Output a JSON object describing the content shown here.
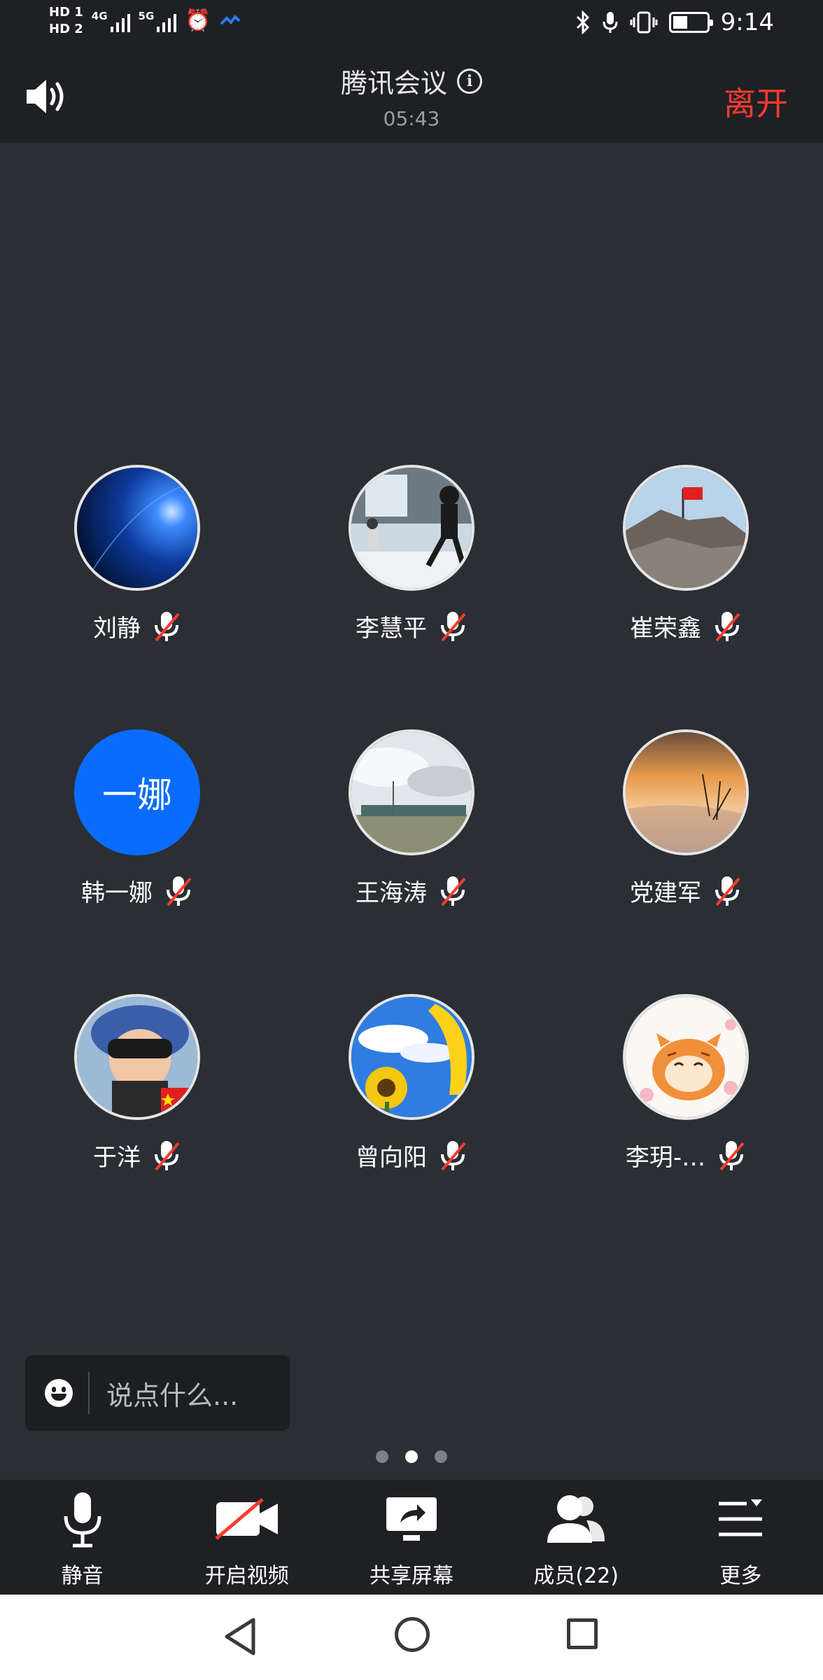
{
  "status_bar": {
    "sim1": "HD 1",
    "sim2": "HD 2",
    "network1": "4G",
    "network2": "5G",
    "time": "9:14"
  },
  "header": {
    "title": "腾讯会议",
    "timer": "05:43",
    "leave_label": "离开"
  },
  "participants": [
    {
      "name": "刘静",
      "avatar": "photo-earth-blue",
      "muted": true
    },
    {
      "name": "李慧平",
      "avatar": "photo-kids-playing",
      "muted": true
    },
    {
      "name": "崔荣鑫",
      "avatar": "photo-mountain-flag",
      "muted": true
    },
    {
      "name": "韩一娜",
      "avatar_text": "一娜",
      "muted": true
    },
    {
      "name": "王海涛",
      "avatar": "photo-train-sky",
      "muted": true
    },
    {
      "name": "党建军",
      "avatar": "photo-snow-sunset",
      "muted": true
    },
    {
      "name": "于洋",
      "avatar": "photo-baby-sunglasses",
      "muted": true
    },
    {
      "name": "曾向阳",
      "avatar": "photo-sunflower",
      "muted": true
    },
    {
      "name": "李玥-…",
      "avatar": "photo-cartoon-tiger",
      "muted": true
    }
  ],
  "chat": {
    "placeholder": "说点什么..."
  },
  "pager": {
    "count": 3,
    "active": 2
  },
  "toolbar": {
    "mute_label": "静音",
    "video_label": "开启视频",
    "share_label": "共享屏幕",
    "members_label": "成员(22)",
    "more_label": "更多"
  },
  "colors": {
    "background": "#2b2e33",
    "bar": "#1e2024",
    "leave": "#ff3b30",
    "avatar_blue": "#0a6cff",
    "muted_slash": "#ff3b30"
  }
}
